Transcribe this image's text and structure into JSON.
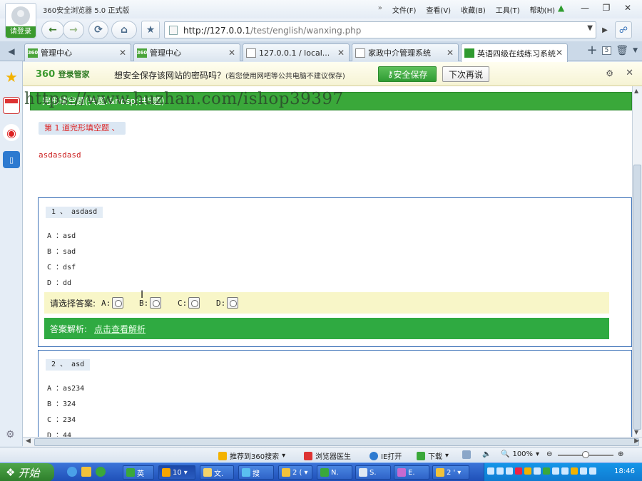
{
  "browser": {
    "title": "360安全浏览器 5.0 正式版",
    "login_label": "请登录",
    "menu": [
      "文件(F)",
      "查看(V)",
      "收藏(B)",
      "工具(T)",
      "帮助(H)"
    ],
    "menu_arrows": "»"
  },
  "nav": {
    "url_host": "http://127.0.0.1",
    "url_path": "/test/english/wanxing.php"
  },
  "tabs": [
    {
      "label": "管理中心",
      "icon": "360-icon",
      "active": false
    },
    {
      "label": "管理中心",
      "icon": "360-icon",
      "active": false
    },
    {
      "label": "127.0.0.1 / local...",
      "icon": "page-icon",
      "active": false
    },
    {
      "label": "家政中介管理系统",
      "icon": "page-icon",
      "active": false
    },
    {
      "label": "英语四级在线练习系统",
      "icon": "green-page-icon",
      "active": true
    }
  ],
  "tab_count": "5",
  "password_bar": {
    "logo": "360",
    "logo_sub": "登录管家",
    "message": "想安全保存该网站的密码吗？",
    "message_note": "(若您使用网吧等公共电脑不建议保存)",
    "save_label": "安全保存",
    "later_label": "下次再说"
  },
  "page": {
    "header": "完形填空题(共题:&nbsp;共5题)",
    "watermark": "https://www.huzhan.com/ishop39397",
    "section_title": "第 1 道完形填空题 、",
    "passage": "asdasdasd",
    "questions": [
      {
        "title": "1 、 asdasd",
        "options": [
          "A ：asd",
          "B ：sad",
          "C ：dsf",
          "D ：dd"
        ],
        "answer_prompt": "请选择答案:",
        "choices": [
          "A:",
          "B:",
          "C:",
          "D:"
        ],
        "analysis_label": "答案解析:",
        "analysis_link": "点击查看解析"
      },
      {
        "title": "2 、 asd",
        "options": [
          "A ：as234",
          "B ：324",
          "C ：234",
          "D ：44"
        ]
      }
    ]
  },
  "statusbar": {
    "recommend": "推荐到360搜索",
    "doctor": "浏览器医生",
    "ie_open": "IE打开",
    "download": "下载",
    "zoom": "100%"
  },
  "taskbar": {
    "start": "开始",
    "buttons": [
      "英",
      "10",
      "文.",
      "搜",
      "2 (",
      "N.",
      "S.",
      "E.",
      "2 '"
    ],
    "time": "18:46"
  }
}
